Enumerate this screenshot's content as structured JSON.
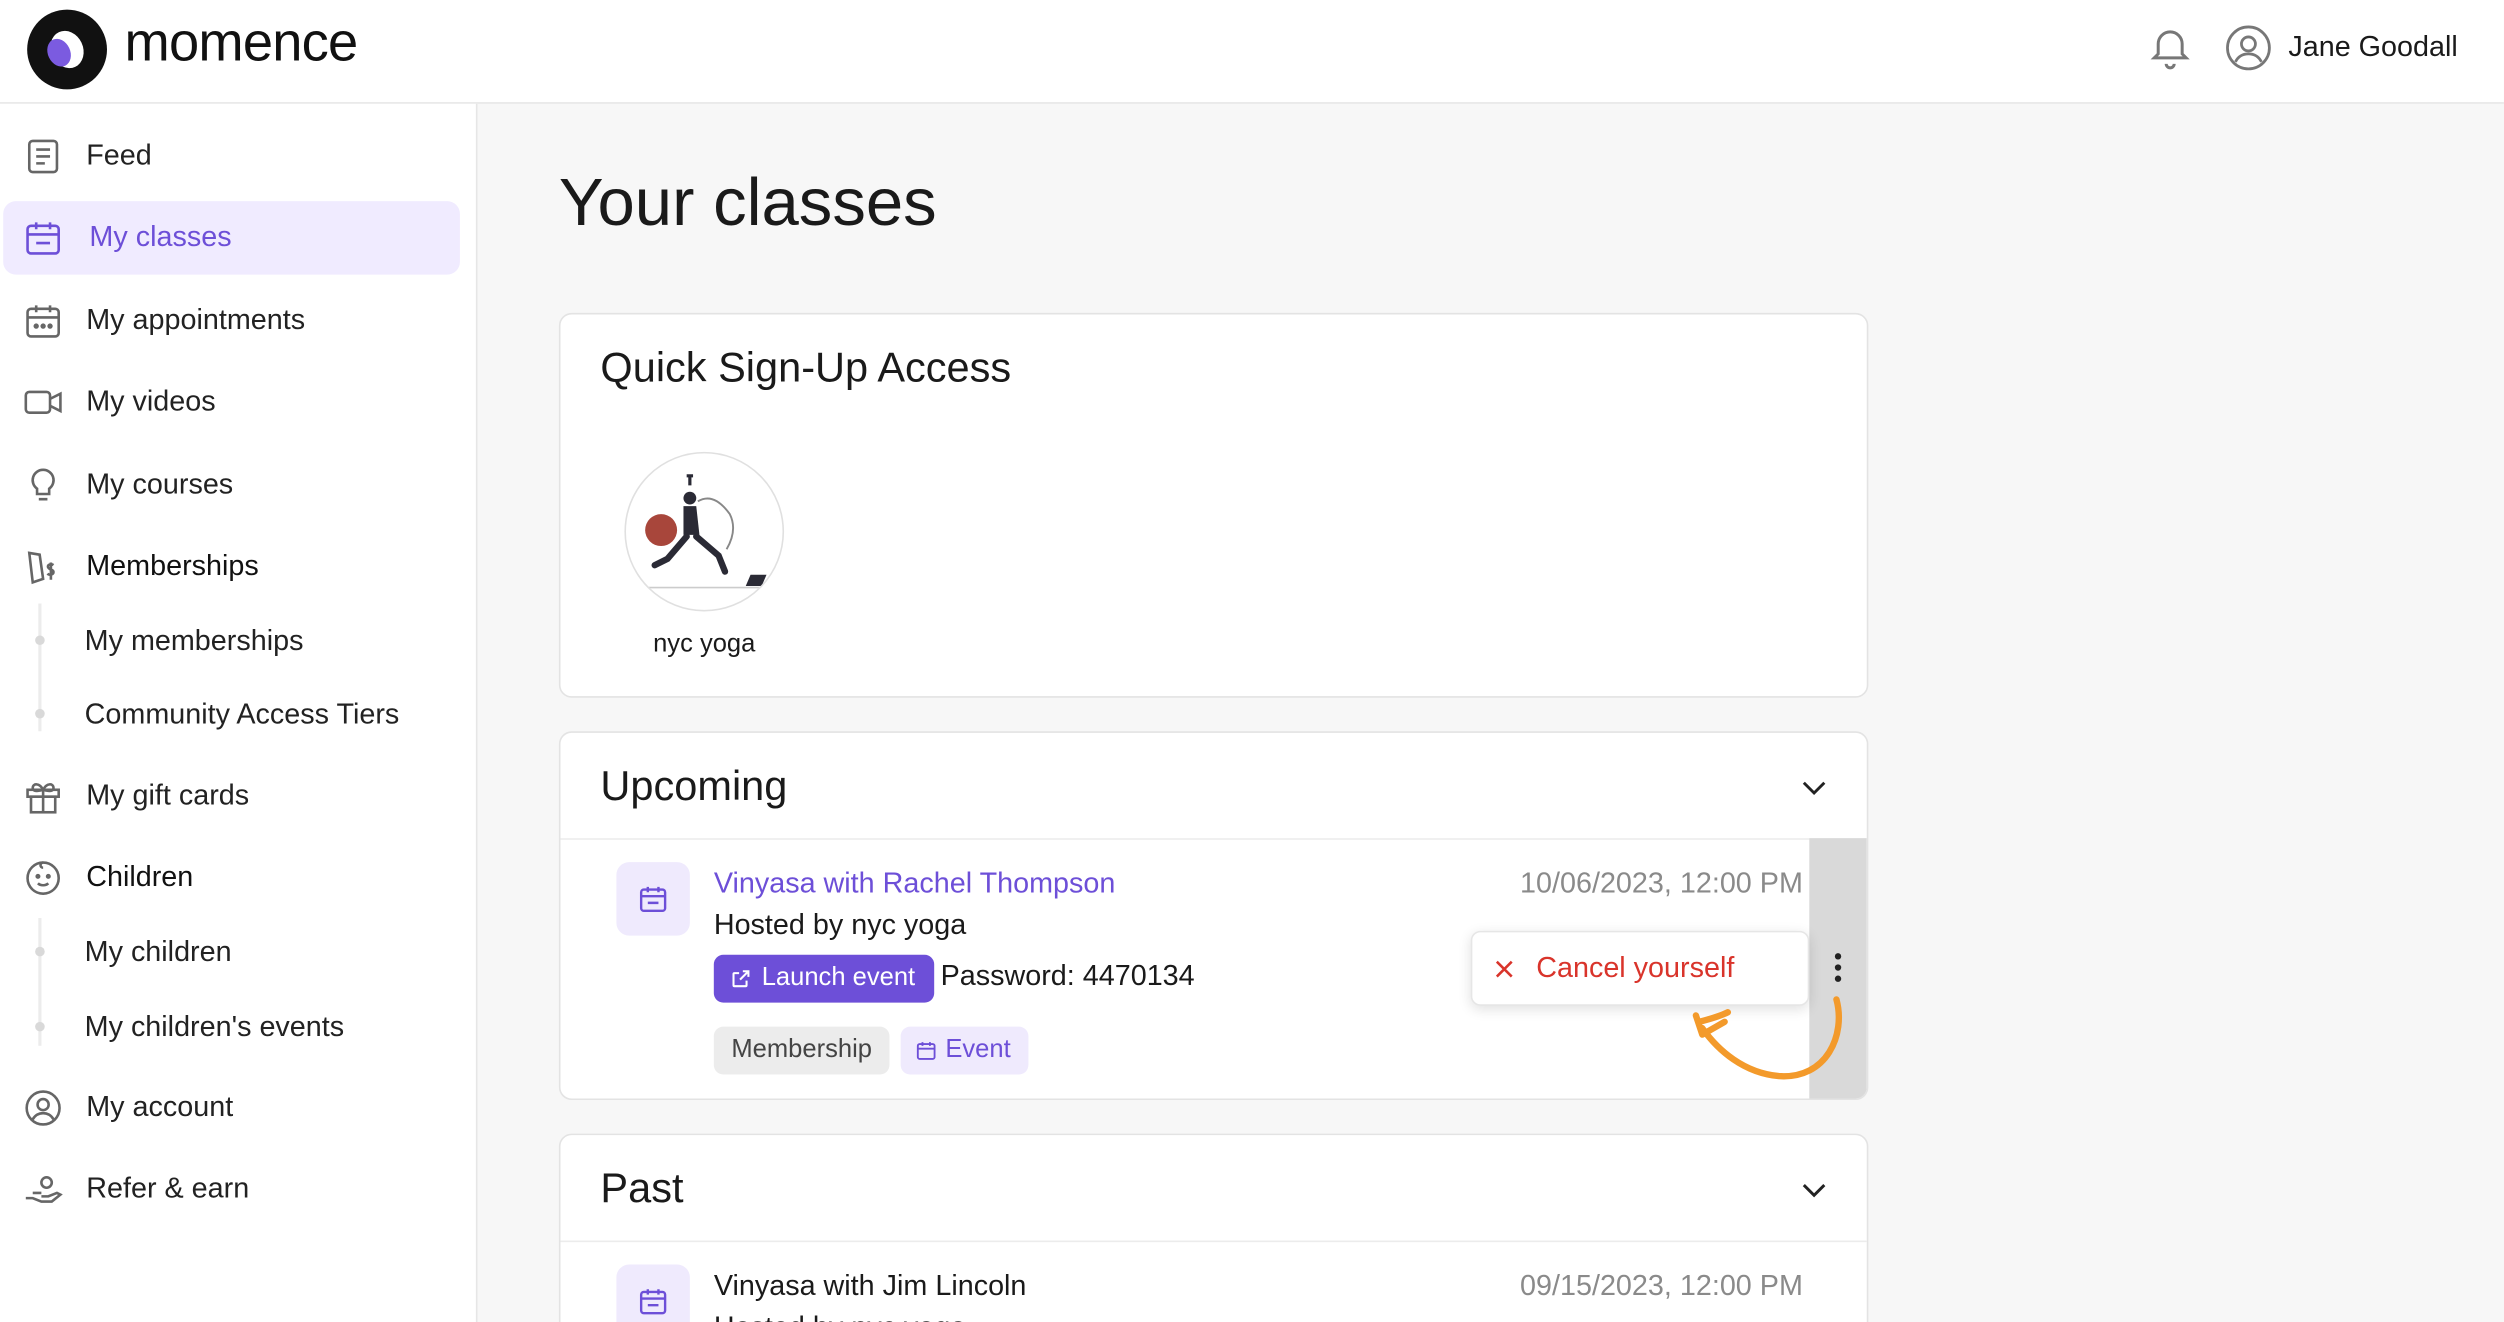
{
  "app": {
    "logo_text": "momence",
    "user_name": "Jane Goodall",
    "colors": {
      "accent": "#6d4fd8",
      "danger": "#d9342b",
      "annotation": "#f39a2b"
    }
  },
  "sidebar": {
    "items": [
      {
        "label": "Feed",
        "icon": "document-icon"
      },
      {
        "label": "My classes",
        "icon": "calendar-icon",
        "active": true
      },
      {
        "label": "My appointments",
        "icon": "calendar-dots-icon"
      },
      {
        "label": "My videos",
        "icon": "video-icon"
      },
      {
        "label": "My courses",
        "icon": "lightbulb-icon"
      },
      {
        "label": "Memberships",
        "icon": "membership-icon"
      },
      {
        "label": "My gift cards",
        "icon": "gift-icon"
      },
      {
        "label": "Children",
        "icon": "baby-icon"
      },
      {
        "label": "My account",
        "icon": "user-circle-icon"
      },
      {
        "label": "Refer & earn",
        "icon": "hand-coin-icon"
      }
    ],
    "memberships_sub": [
      "My memberships",
      "Community Access Tiers"
    ],
    "children_sub": [
      "My children",
      "My children's events"
    ]
  },
  "main": {
    "title": "Your classes",
    "quick_signup": {
      "heading": "Quick Sign-Up Access",
      "studios": [
        {
          "name": "nyc yoga"
        }
      ]
    },
    "upcoming": {
      "heading": "Upcoming",
      "classes": [
        {
          "title": "Vinyasa with Rachel Thompson",
          "date": "10/06/2023, 12:00 PM",
          "host": "Hosted by nyc yoga",
          "launch_label": "Launch event",
          "password": "Password: 4470134",
          "tags": [
            "Membership",
            "Event"
          ]
        }
      ],
      "menu": {
        "cancel_label": "Cancel yourself"
      }
    },
    "past": {
      "heading": "Past",
      "classes": [
        {
          "title": "Vinyasa with Jim Lincoln",
          "date": "09/15/2023, 12:00 PM",
          "host": "Hosted by nyc yoga"
        }
      ]
    }
  }
}
